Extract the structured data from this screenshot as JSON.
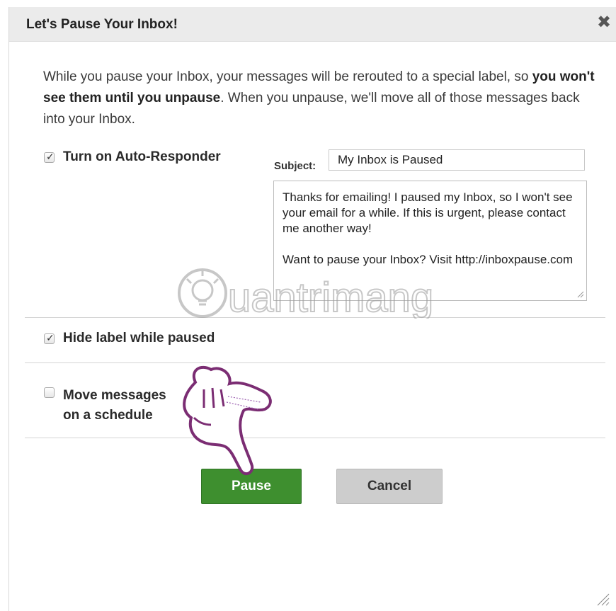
{
  "dialog": {
    "title": "Let's Pause Your Inbox!",
    "close_glyph": "✖"
  },
  "intro": {
    "part1": "While you pause your Inbox, your messages will be rerouted to a special label, so ",
    "bold": "you won't see them until you unpause",
    "part2": ". When you unpause, we'll move all of those messages back into your Inbox."
  },
  "options": {
    "auto_responder": {
      "label": "Turn on Auto-Responder",
      "checked": true
    },
    "hide_label": {
      "label": "Hide label while paused",
      "checked": true
    },
    "schedule": {
      "label_line1": "Move messages",
      "label_line2": "on a schedule",
      "checked": false
    }
  },
  "auto_responder": {
    "subject_label": "Subject:",
    "subject_value": "My Inbox is Paused",
    "message": "Thanks for emailing! I paused my Inbox, so I won't see your email for a while. If this is urgent, please contact me another way!\n\nWant to pause your Inbox? Visit http://inboxpause.com"
  },
  "buttons": {
    "pause": "Pause",
    "cancel": "Cancel"
  },
  "colors": {
    "pause_button": "#3e8f2f",
    "cancel_button": "#cdcdcd",
    "titlebar": "#ebebeb",
    "hand_outline": "#7b2d73"
  },
  "watermark": {
    "text": "Quantrimang"
  }
}
